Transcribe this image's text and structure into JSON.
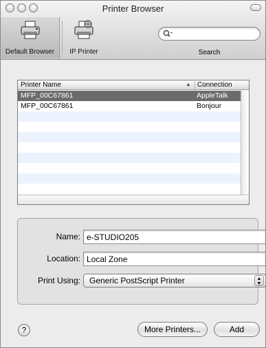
{
  "window": {
    "title": "Printer Browser"
  },
  "toolbar": {
    "default_browser_label": "Default Browser",
    "ip_printer_label": "IP Printer",
    "search_label": "Search",
    "search_value": ""
  },
  "printer_table": {
    "columns": [
      "Printer Name",
      "Connection"
    ],
    "rows": [
      {
        "name": "MFP_00C67861",
        "connection": "AppleTalk",
        "selected": true
      },
      {
        "name": "MFP_00C67861",
        "connection": "Bonjour",
        "selected": false
      }
    ]
  },
  "details": {
    "name_label": "Name:",
    "name_value": "e-STUDIO205",
    "location_label": "Location:",
    "location_value": "Local Zone",
    "print_using_label": "Print Using:",
    "print_using_value": "Generic PostScript Printer"
  },
  "buttons": {
    "help": "?",
    "more_printers": "More Printers...",
    "add": "Add"
  }
}
